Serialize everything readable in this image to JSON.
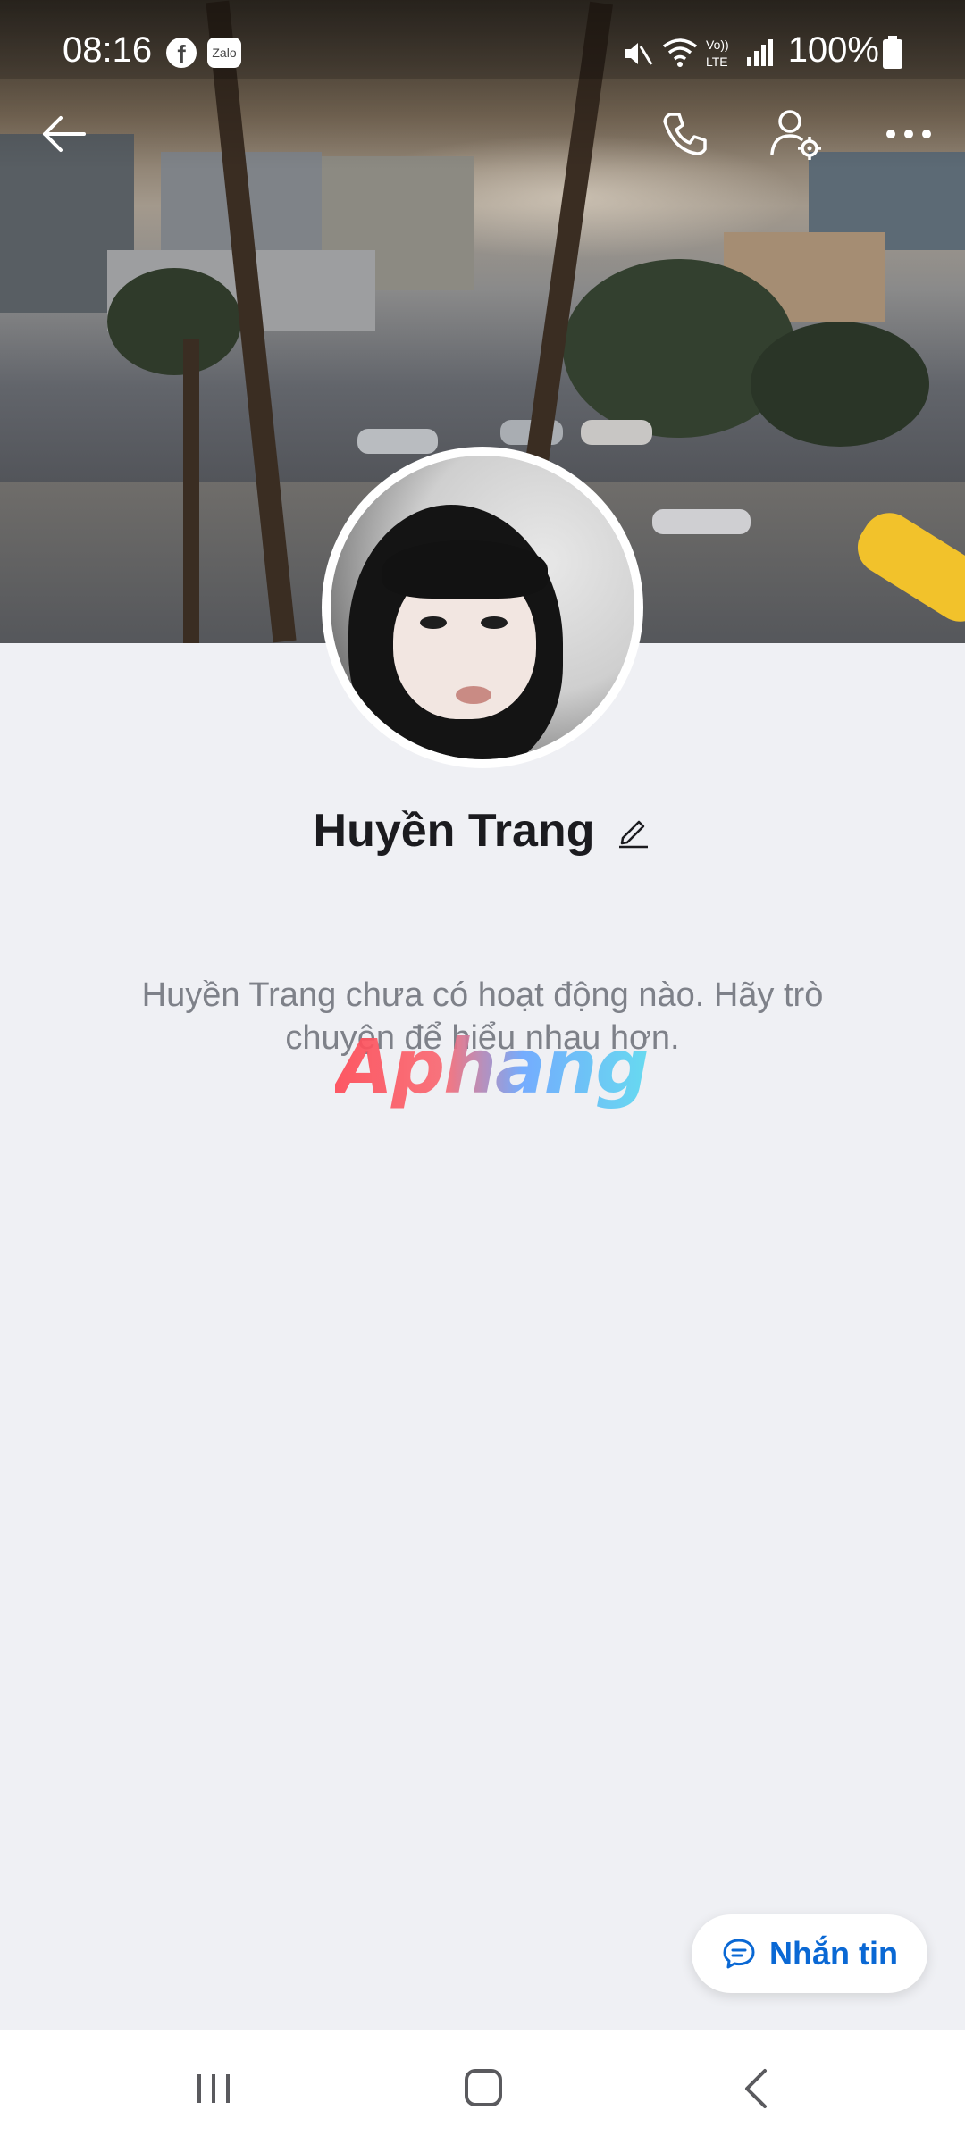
{
  "status_bar": {
    "time": "08:16",
    "right_text": "100%",
    "icons": [
      "facebook-icon",
      "zalo-icon",
      "mute-icon",
      "wifi-icon",
      "volte-icon",
      "signal-icon",
      "battery-icon"
    ]
  },
  "top_nav": {
    "icons": [
      "back-arrow-icon",
      "phone-icon",
      "user-settings-icon",
      "more-icon"
    ]
  },
  "profile": {
    "name": "Huyền Trang",
    "empty_message": "Huyền Trang chưa có hoạt động nào. Hãy trò chuyện để hiểu nhau hơn."
  },
  "watermark": {
    "text": "Aphang"
  },
  "message_button": {
    "label": "Nhắn tin",
    "color": "#0a68d4"
  },
  "system_nav": {
    "icons": [
      "recents-icon",
      "home-icon",
      "back-icon"
    ]
  }
}
